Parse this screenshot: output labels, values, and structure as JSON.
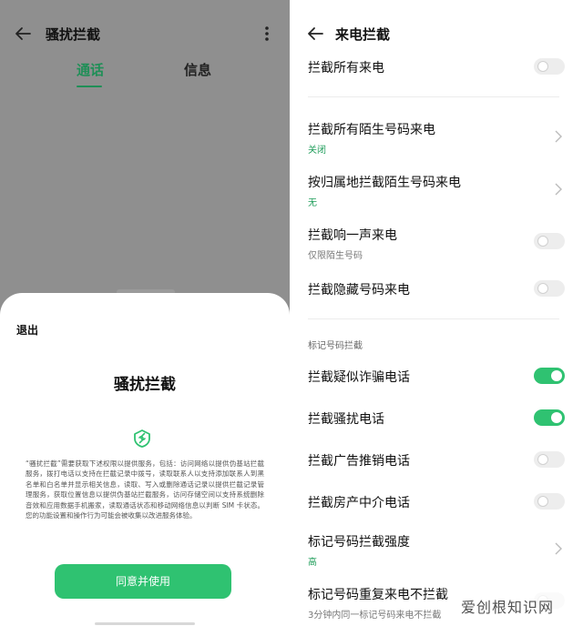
{
  "left": {
    "title": "骚扰拦截",
    "tabs": [
      "通话",
      "信息"
    ],
    "sheet": {
      "exit_label": "退出",
      "title": "骚扰拦截",
      "description": "“骚扰拦截”需要获取下述权限以提供服务，包括：访问网络以提供伪基站拦截服务，拨打电话以支持在拦截记录中拨号，读取联系人以支持添加联系人到黑名单和白名单并显示相关信息，读取、写入或删除通话记录以提供拦截记录管理服务，获取位置信息以提供伪基站拦截服务，访问存储空间以支持系统删除音效和应用数据手机搬家，读取通话状态和移动网络信息以判断 SIM 卡状态。您的功能设置和操作行为可能会被收集以改进服务体验。",
      "agree_button": "同意并使用",
      "icons": {
        "shield": "shield-icon"
      },
      "accent": "#2fc271"
    }
  },
  "right": {
    "title": "来电拦截",
    "rows": [
      {
        "label": "拦截所有来电",
        "type": "toggle",
        "on": false
      },
      {
        "label": "拦截所有陌生号码来电",
        "type": "chevron",
        "sub": "关闭",
        "sub_color": "green"
      },
      {
        "label": "按归属地拦截陌生号码来电",
        "type": "chevron",
        "sub": "无",
        "sub_color": "green"
      },
      {
        "label": "拦截响一声来电",
        "type": "toggle",
        "on": false,
        "sub": "仅限陌生号码",
        "sub_color": "gray"
      },
      {
        "label": "拦截隐藏号码来电",
        "type": "toggle",
        "on": false
      }
    ],
    "section_title": "标记号码拦截",
    "marked_rows": [
      {
        "label": "拦截疑似诈骗电话",
        "type": "toggle",
        "on": true
      },
      {
        "label": "拦截骚扰电话",
        "type": "toggle",
        "on": true
      },
      {
        "label": "拦截广告推销电话",
        "type": "toggle",
        "on": false
      },
      {
        "label": "拦截房产中介电话",
        "type": "toggle",
        "on": false
      },
      {
        "label": "标记号码拦截强度",
        "type": "chevron",
        "sub": "高",
        "sub_color": "green"
      },
      {
        "label": "标记号码重复来电不拦截",
        "type": "toggle",
        "on": false,
        "sub": "3分钟内同一标记号码来电不拦截",
        "sub_color": "gray"
      }
    ]
  },
  "watermark": "爱创根知识网",
  "colors": {
    "accent_green": "#2fc271",
    "tab_green": "#1f8f57",
    "overlay_gray": "#8f8f8f"
  }
}
